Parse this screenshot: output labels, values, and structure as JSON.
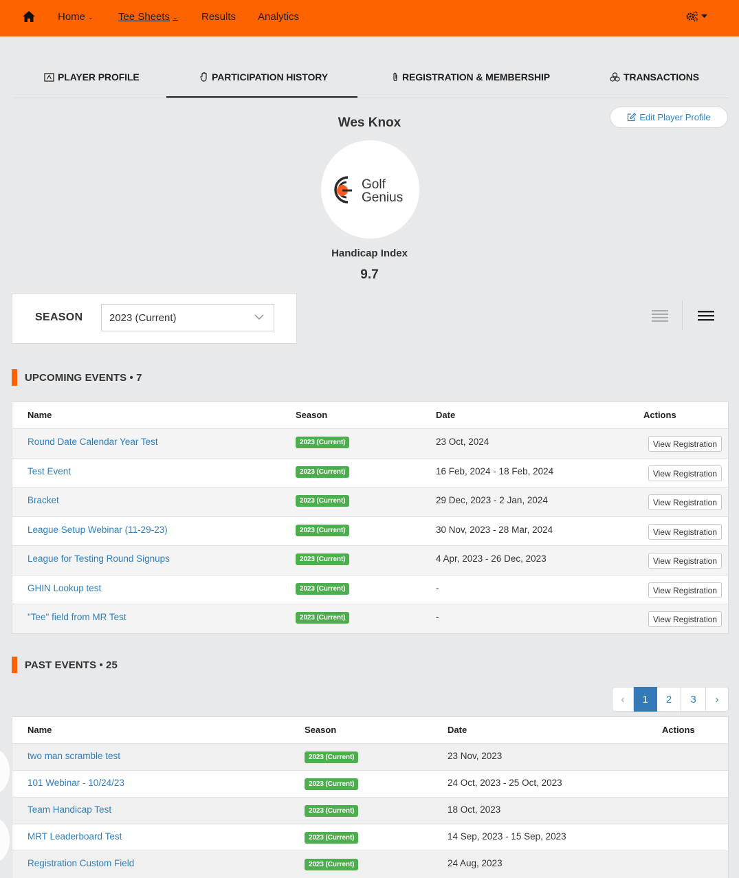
{
  "nav": {
    "items": [
      {
        "label": "Home",
        "dropdown": true
      },
      {
        "label": "Tee Sheets",
        "dropdown": true
      },
      {
        "label": "Results",
        "dropdown": false
      },
      {
        "label": "Analytics",
        "dropdown": false
      }
    ],
    "icons": {
      "home": "home-icon",
      "settings": "gears-icon"
    },
    "accent_color": "#ff6300"
  },
  "tabs": [
    {
      "label": "PLAYER PROFILE",
      "icon": "id-card-icon"
    },
    {
      "label": "PARTICIPATION HISTORY",
      "icon": "hand-icon",
      "active": true
    },
    {
      "label": "REGISTRATION & MEMBERSHIP",
      "icon": "paperclip-icon"
    },
    {
      "label": "TRANSACTIONS",
      "icon": "coins-icon"
    }
  ],
  "profile": {
    "edit_label": "Edit Player Profile",
    "name": "Wes Knox",
    "logo_line1": "Golf",
    "logo_line2": "Genius",
    "handicap_label": "Handicap Index",
    "handicap_value": "9.7"
  },
  "season": {
    "label": "SEASON",
    "selected": "2023 (Current)"
  },
  "upcoming": {
    "title": "UPCOMING EVENTS • 7",
    "columns": [
      "Name",
      "Season",
      "Date",
      "Actions"
    ],
    "action_label": "View Registration",
    "rows": [
      {
        "name": "Round Date Calendar Year Test",
        "season": "2023 (Current)",
        "date": "23 Oct, 2024"
      },
      {
        "name": "Test Event",
        "season": "2023 (Current)",
        "date": "16 Feb, 2024 - 18 Feb, 2024"
      },
      {
        "name": "Bracket",
        "season": "2023 (Current)",
        "date": "29 Dec, 2023 - 2 Jan, 2024"
      },
      {
        "name": "League Setup Webinar (11-29-23)",
        "season": "2023 (Current)",
        "date": "30 Nov, 2023 - 28 Mar, 2024"
      },
      {
        "name": "League for Testing Round Signups",
        "season": "2023 (Current)",
        "date": "4 Apr, 2023 - 26 Dec, 2023"
      },
      {
        "name": "GHIN Lookup test",
        "season": "2023 (Current)",
        "date": "-"
      },
      {
        "name": "\"Tee\" field from MR Test",
        "season": "2023 (Current)",
        "date": "-"
      }
    ]
  },
  "past": {
    "title": "PAST EVENTS • 25",
    "columns": [
      "Name",
      "Season",
      "Date",
      "Actions"
    ],
    "pagination": {
      "prev": "‹",
      "pages": [
        "1",
        "2",
        "3"
      ],
      "next": "›",
      "current": "1"
    },
    "rows": [
      {
        "name": "two man scramble test",
        "season": "2023 (Current)",
        "date": "23 Nov, 2023"
      },
      {
        "name": "101 Webinar - 10/24/23",
        "season": "2023 (Current)",
        "date": "24 Oct, 2023 - 25 Oct, 2023"
      },
      {
        "name": "Team Handicap Test",
        "season": "2023 (Current)",
        "date": "18 Oct, 2023"
      },
      {
        "name": "MRT Leaderboard Test",
        "season": "2023 (Current)",
        "date": "14 Sep, 2023 - 15 Sep, 2023"
      },
      {
        "name": "Registration Custom Field",
        "season": "2023 (Current)",
        "date": "24 Aug, 2023"
      }
    ]
  }
}
